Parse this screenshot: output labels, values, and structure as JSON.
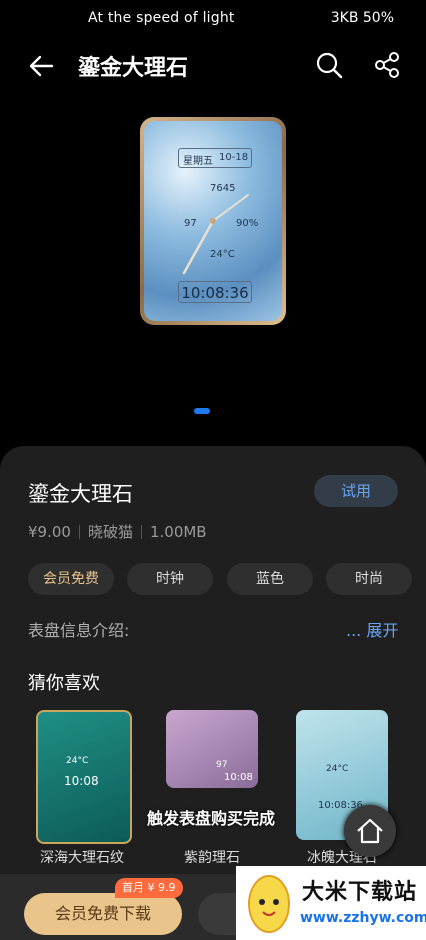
{
  "status": {
    "left": "At the speed of light",
    "right": "3KB 50%"
  },
  "header": {
    "title": "鎏金大理石"
  },
  "watch_preview": {
    "weekday": "星期五",
    "date": "10-18",
    "steps": "7645",
    "heart": "97",
    "battery": "90%",
    "temp": "24°C",
    "time": "10:08:36"
  },
  "detail": {
    "name": "鎏金大理石",
    "trial_label": "试用",
    "price": "¥9.00",
    "author": "晓破猫",
    "size": "1.00MB",
    "tags": [
      "会员免费",
      "时钟",
      "蓝色",
      "时尚"
    ],
    "intro_label": "表盘信息介绍:",
    "intro_more": "... 展开",
    "guess_title": "猜你喜欢",
    "recommend": [
      {
        "name": "深海大理石纹",
        "time": "10:08",
        "extra": "24°C"
      },
      {
        "name": "紫韵理石",
        "time": "10:08",
        "extra": "97"
      },
      {
        "name": "冰魄大理石",
        "time": "10:08:36",
        "extra": "24°C"
      }
    ],
    "toast": "触发表盘购买完成"
  },
  "bottom": {
    "vip_button": "会员免费下载",
    "first_month": "首月 ¥ 9.9"
  },
  "ad": {
    "title": "大米下载站",
    "url": "www.zzhyw.com"
  },
  "colors": {
    "accent": "#1e7bf0",
    "vip": "#e9c48b",
    "link": "#6aa4f2"
  }
}
